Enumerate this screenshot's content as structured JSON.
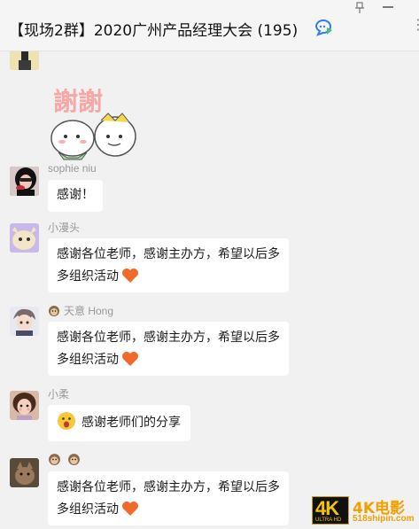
{
  "window": {
    "title": "【现场2群】2020广州产品经理大会 (195)"
  },
  "icons": {
    "title_badge": "chat-bubble-icon",
    "pin": "pin-icon",
    "minimize": "minimize-icon",
    "more": "more-icon"
  },
  "colors": {
    "window_background": "#f1f1f1",
    "bubble": "#ffffff",
    "sender_name": "#999999",
    "heart": "#f06a2a",
    "badge_blue": "#2f7bea",
    "badge_green": "#3fc46a"
  },
  "messages": [
    {
      "sender": "",
      "type": "sticker",
      "sticker_text": "謝謝"
    },
    {
      "sender": "sophie niu",
      "type": "text",
      "text": "感谢！"
    },
    {
      "sender": "小漫头",
      "type": "text",
      "lines": [
        "感谢各位老师，感谢主办方，希望以后多",
        "多组织活动"
      ],
      "trailing_emoji": "heart-icon"
    },
    {
      "sender_prefix_emoji": "monkey-icon",
      "sender": "天意 Hong",
      "type": "text",
      "lines": [
        "感谢各位老师，感谢主办方，希望以后多",
        "多组织活动"
      ],
      "trailing_emoji": "heart-icon"
    },
    {
      "sender": "小柔",
      "type": "text",
      "leading_emoji": "face-icon",
      "text": "感谢老师们的分享"
    },
    {
      "sender": "",
      "sender_emojis": [
        "monkey-icon",
        "monkey-icon"
      ],
      "type": "text",
      "lines": [
        "感谢各位老师，感谢主办方，希望以后多",
        "多组织活动"
      ],
      "trailing_emoji": "heart-icon"
    }
  ],
  "watermark": {
    "logo": "4K",
    "logo_sub": "ULTRA HD",
    "brand": "4K电影",
    "site": "518shipin.com"
  }
}
